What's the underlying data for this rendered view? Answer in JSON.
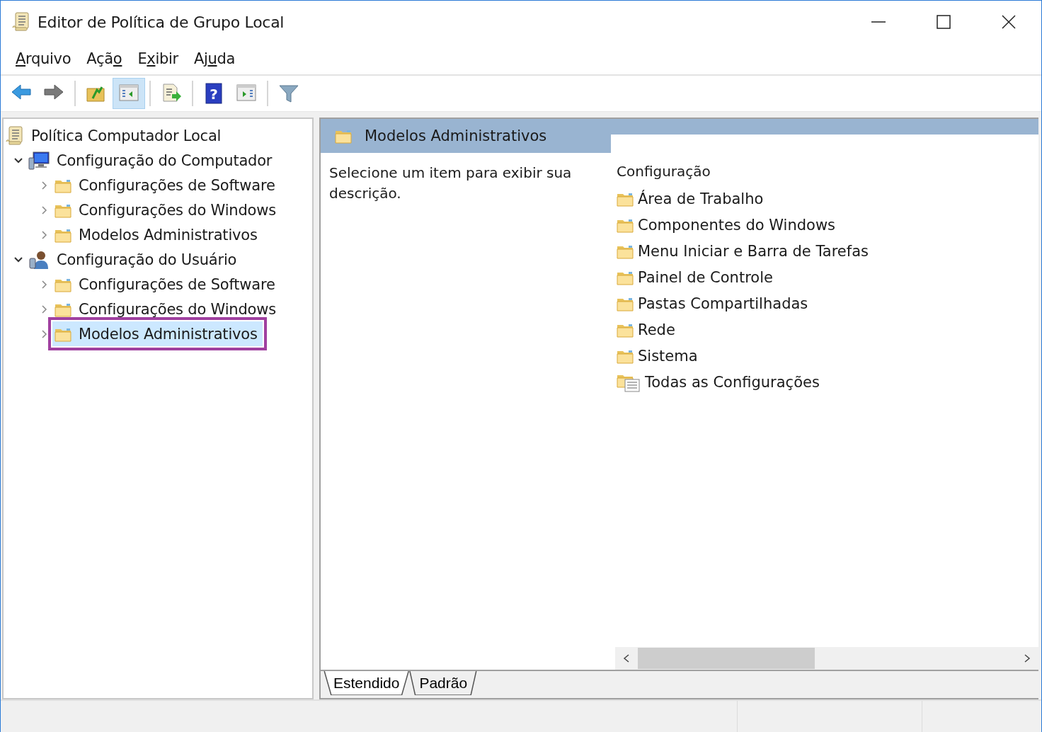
{
  "window": {
    "title": "Editor de Política de Grupo Local"
  },
  "menu": [
    {
      "label": "Arquivo"
    },
    {
      "label": "Ação"
    },
    {
      "label": "Exibir"
    },
    {
      "label": "Ajuda"
    }
  ],
  "toolbar": [
    [
      {
        "kind": "back",
        "selected": false
      },
      {
        "kind": "forward",
        "selected": false
      }
    ],
    [
      {
        "kind": "up",
        "selected": false
      },
      {
        "kind": "tree",
        "selected": true
      }
    ],
    [
      {
        "kind": "export",
        "selected": false
      }
    ],
    [
      {
        "kind": "help",
        "glyph": "?",
        "selected": false
      },
      {
        "kind": "action",
        "selected": false
      }
    ],
    [
      {
        "kind": "filter",
        "selected": false
      }
    ]
  ],
  "tree": [
    {
      "label": "Política Computador Local",
      "kind": "scroll",
      "selected": false,
      "outlined": false,
      "children": [
        {
          "label": "Configuração do Computador",
          "kind": "computer",
          "expanded": true,
          "selected": false,
          "outlined": false,
          "children": [
            {
              "label": "Configurações de Software",
              "kind": "folder",
              "expanded": false,
              "selected": false,
              "outlined": false
            },
            {
              "label": "Configurações do Windows",
              "kind": "folder",
              "expanded": false,
              "selected": false,
              "outlined": false
            },
            {
              "label": "Modelos Administrativos",
              "kind": "folder",
              "expanded": false,
              "selected": false,
              "outlined": false
            }
          ]
        },
        {
          "label": "Configuração do Usuário",
          "kind": "user",
          "expanded": true,
          "selected": false,
          "outlined": false,
          "children": [
            {
              "label": "Configurações de Software",
              "kind": "folder",
              "expanded": false,
              "selected": false,
              "outlined": false
            },
            {
              "label": "Configurações do Windows",
              "kind": "folder",
              "expanded": false,
              "selected": false,
              "outlined": false
            },
            {
              "label": "Modelos Administrativos",
              "kind": "folder",
              "expanded": false,
              "selected": true,
              "outlined": true
            }
          ]
        }
      ]
    }
  ],
  "details": {
    "title": "Modelos Administrativos",
    "description": "Selecione um item para exibir sua descrição.",
    "column": "Configuração",
    "items": [
      {
        "label": "Área de Trabalho",
        "kind": "folder"
      },
      {
        "label": "Componentes do Windows",
        "kind": "folder"
      },
      {
        "label": "Menu Iniciar e Barra de Tarefas",
        "kind": "folder"
      },
      {
        "label": "Painel de Controle",
        "kind": "folder"
      },
      {
        "label": "Pastas Compartilhadas",
        "kind": "folder"
      },
      {
        "label": "Rede",
        "kind": "folder"
      },
      {
        "label": "Sistema",
        "kind": "folder"
      },
      {
        "label": "Todas as Configurações",
        "kind": "settings"
      }
    ]
  },
  "view_tabs": [
    {
      "label": "Estendido",
      "selected": true
    },
    {
      "label": "Padrão",
      "selected": false
    }
  ]
}
